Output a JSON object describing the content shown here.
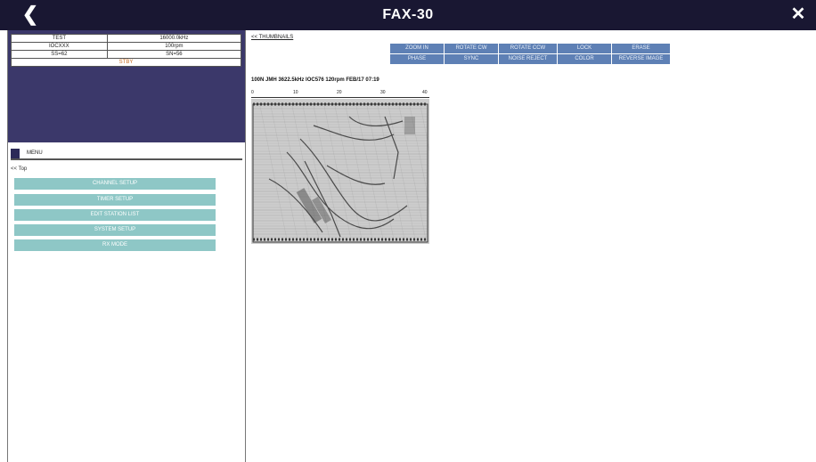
{
  "window": {
    "title": "FAX-30",
    "back_icon": "chevron-left-icon",
    "close_icon": "close-icon"
  },
  "status": {
    "rows": [
      [
        "TEST",
        "16000.0kHz"
      ],
      [
        "IOCXXX",
        "100rpm"
      ],
      [
        "SS=62",
        "SN=56"
      ]
    ],
    "state": "STBY"
  },
  "menu": {
    "header": "MENU",
    "top_link": "<< Top",
    "items": [
      "CHANNEL SETUP",
      "TIMER SETUP",
      "EDIT STATION LIST",
      "SYSTEM SETUP",
      "RX MODE"
    ]
  },
  "viewer": {
    "thumbnails_link": "<< THUMBNAILS",
    "toolbar": [
      "ZOOM IN",
      "ROTATE CW",
      "ROTATE CCW",
      "LOCK",
      "ERASE",
      "PHASE",
      "SYNC",
      "NOISE REJECT",
      "COLOR",
      "REVERSE IMAGE"
    ],
    "fax_title": "100N JMH 3622.5kHz IOC576 120rpm FEB/17 07:19",
    "ruler_ticks": [
      "0",
      "10",
      "20",
      "30",
      "40"
    ]
  },
  "colors": {
    "titlebar": "#191732",
    "status_bg": "#3b386a",
    "menu_button": "#8ec7c6",
    "toolbar_button": "#5e80b5",
    "stby": "#c46a1e"
  }
}
